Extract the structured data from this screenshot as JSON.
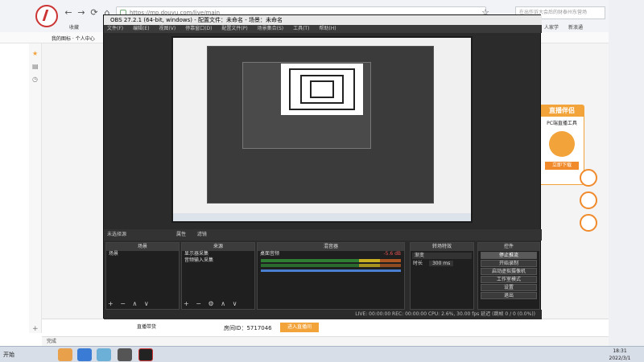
{
  "browser": {
    "url": "https://mp.douyu.com/live/main",
    "search_placeholder": "在出作诉大会后的财泰州东营场",
    "bookmark_label": "收藏",
    "bookmark_item": "我的图标 · 个人中心",
    "tab_right_1": "人家学",
    "tab_right_2": "新浪通",
    "status": "完成"
  },
  "obs": {
    "title": "OBS 27.2.1 (64-bit, windows) - 配置文件：未命名 - 场景：未命名",
    "menu": [
      "文件(F)",
      "编辑(E)",
      "视图(V)",
      "停靠窗口(D)",
      "配置文件(P)",
      "场景集合(S)",
      "工具(T)",
      "帮助(H)"
    ],
    "scene_toolbar": {
      "label": "未选择源",
      "props": "属性",
      "filters": "滤镜"
    },
    "scenes": {
      "header": "场景",
      "items": [
        "场景"
      ]
    },
    "sources": {
      "header": "来源",
      "items": [
        "显示器采集",
        "音频输入采集"
      ]
    },
    "mixer": {
      "header": "混音器",
      "channel": "桌面音频",
      "level": "-5.6 dB"
    },
    "transitions": {
      "header": "转场特效",
      "type": "渐变",
      "duration_label": "时长",
      "duration": "300 ms"
    },
    "controls": {
      "header": "控件",
      "buttons": [
        "停止推流",
        "开始录制",
        "启动虚拟摄像机",
        "工作室模式",
        "设置",
        "退出"
      ]
    },
    "status_bar": "LIVE: 00:00:00   REC: 00:00:00   CPU: 2.6%, 30.00 fps   延迟 (跳帧 0 / 0 (0.0%))"
  },
  "page": {
    "promo_title": "直播伴侣",
    "promo_sub": "PC端直播工具",
    "promo_btn": "立即下载",
    "room_label": "直播带货",
    "room_id": "房间ID：5717046",
    "enter_room_btn": "进入直播间"
  },
  "taskbar": {
    "start": "开始",
    "time": "18:31",
    "date": "2022/3/1"
  },
  "colors": {
    "accent": "#f2a33a",
    "obs_bg": "#2b2b2b",
    "meter_green": "#2e7d32"
  }
}
